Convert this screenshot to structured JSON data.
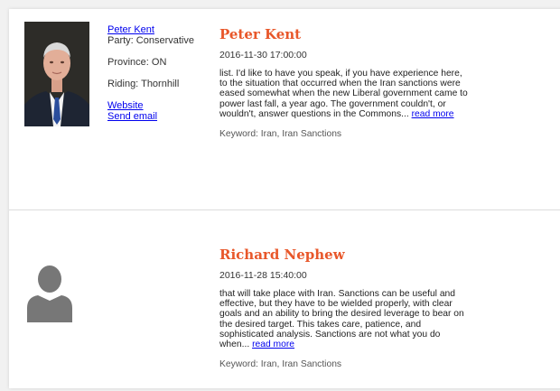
{
  "entries": [
    {
      "name": "Peter Kent",
      "party": "Party: Conservative",
      "province": "Province: ON",
      "riding": "Riding: Thornhill",
      "website_label": "Website",
      "email_label": "Send email",
      "date": "2016-11-30 17:00:00",
      "excerpt": "list. I'd like to have you speak, if you have experience here, to the situation that occurred when the Iran sanctions were eased somewhat when the new Liberal government came to power last fall, a year ago. The government couldn't, or wouldn't, answer questions in the Commons...",
      "read_more": "read more",
      "keyword": "Keyword: Iran, Iran Sanctions"
    },
    {
      "name": "Richard Nephew",
      "date": "2016-11-28 15:40:00",
      "excerpt": "that will take place with Iran. Sanctions can be useful and effective, but they have to be wielded properly, with clear goals and an ability to bring the desired leverage to bear on the desired target. This takes care, patience, and sophisticated analysis. Sanctions are not what you do when...",
      "read_more": "read more",
      "keyword": "Keyword: Iran, Iran Sanctions"
    }
  ],
  "colors": {
    "name": "#e8572a",
    "link": "#0000ee",
    "avatar": "#777777"
  },
  "icons": {
    "placeholder_avatar": "person-silhouette-icon"
  }
}
